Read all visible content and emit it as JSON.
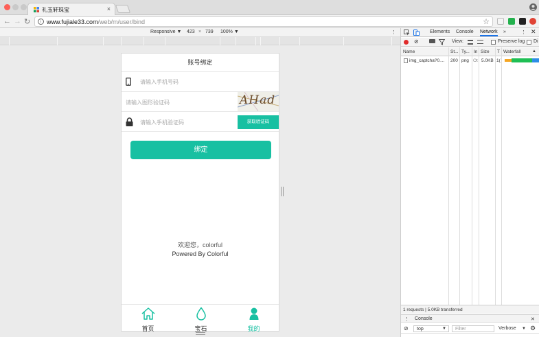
{
  "browser": {
    "tab_title": "礼玉轩珠宝",
    "tab_close": "×",
    "url_host": "www.fujiale33.com",
    "url_path": "/web/m/user/bind"
  },
  "device_toolbar": {
    "device": "Responsive ▼",
    "width": "423",
    "times": "×",
    "height": "739",
    "zoom": "100% ▼",
    "more": "⋮"
  },
  "page": {
    "title": "账号绑定",
    "phone_placeholder": "请输入手机号码",
    "captcha_placeholder": "请输入图形验证码",
    "captcha_text": "AHad",
    "sms_placeholder": "请输入手机验证码",
    "sms_button": "获取验证码",
    "bind_button": "绑定",
    "welcome": "欢迎您，colorful",
    "powered_by": "Powered By Colorful",
    "tabs": [
      {
        "label": "首页",
        "icon": "home-icon"
      },
      {
        "label": "宝石",
        "icon": "gem-drop-icon"
      },
      {
        "label": "我的",
        "icon": "user-icon"
      }
    ],
    "accent_color": "#18c0a2"
  },
  "devtools": {
    "tabs": [
      "Elements",
      "Console",
      "Network",
      "»"
    ],
    "active_tab": "Network",
    "toolbar": {
      "view_label": "View:",
      "preserve_log": "Preserve log",
      "disable_cache_cut": "Di"
    },
    "columns": [
      "Name",
      "St...",
      "Ty...",
      "In",
      "Size",
      "T",
      "Waterfall"
    ],
    "waterfall_sort": "▲",
    "rows": [
      {
        "name": "img_captcha?0....",
        "status": "200",
        "type": "png",
        "initiator": "Ot",
        "size": "5.0KB",
        "time": "1("
      }
    ],
    "status": "1 requests | 5.0KB transferred",
    "drawer_tab": "Console",
    "console_context": "top",
    "console_filter_placeholder": "Filter",
    "console_level": "Verbose"
  }
}
